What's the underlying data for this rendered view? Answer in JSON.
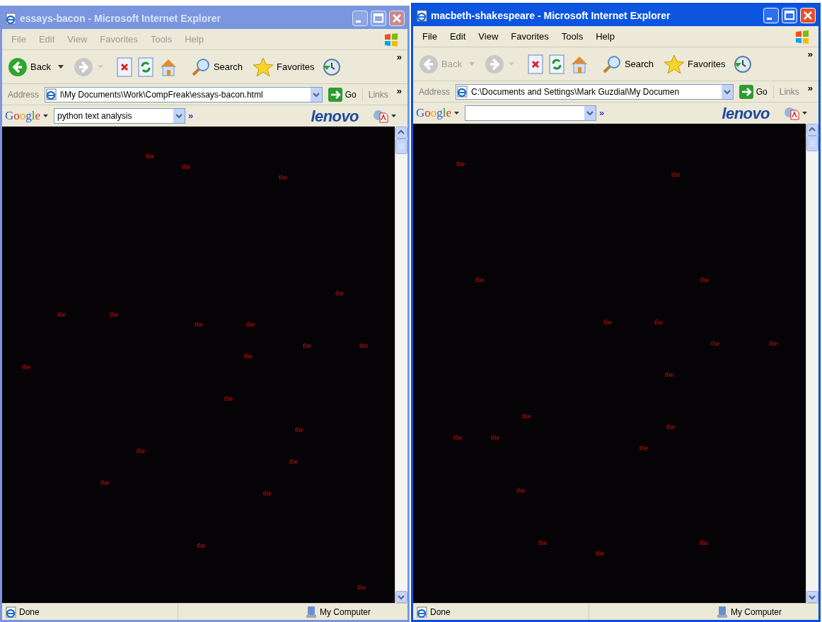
{
  "windows": [
    {
      "title": "essays-bacon - Microsoft Internet Explorer",
      "active": false,
      "menu": [
        "File",
        "Edit",
        "View",
        "Favorites",
        "Tools",
        "Help"
      ],
      "toolbar": {
        "back": {
          "label": "Back",
          "disabled": false
        },
        "search": "Search",
        "favorites": "Favorites",
        "more": "»"
      },
      "address": {
        "label": "Address",
        "value": "l\\My Documents\\Work\\CompFreak\\essays-bacon.html",
        "go": "Go",
        "links": "Links",
        "more": "»"
      },
      "google": {
        "logo": "Google",
        "query": "python text analysis",
        "more": "»",
        "brand": "lenovo"
      },
      "words": [
        "the",
        "the",
        "the",
        "the",
        "the",
        "the",
        "the",
        "the",
        "the",
        "the",
        "the",
        "the",
        "the",
        "the",
        "the",
        "the",
        "the",
        "the",
        "the",
        "the"
      ],
      "status": {
        "text": "Done",
        "zone": "My Computer"
      }
    },
    {
      "title": "macbeth-shakespeare - Microsoft Internet Explorer",
      "active": true,
      "menu": [
        "File",
        "Edit",
        "View",
        "Favorites",
        "Tools",
        "Help"
      ],
      "toolbar": {
        "back": {
          "label": "Back",
          "disabled": true
        },
        "search": "Search",
        "favorites": "Favorites",
        "more": "»"
      },
      "address": {
        "label": "Address",
        "value": "C:\\Documents and Settings\\Mark Guzdial\\My Documen",
        "go": "Go",
        "links": "Links",
        "more": "»"
      },
      "google": {
        "logo": "Google",
        "more": "»",
        "brand": "lenovo"
      },
      "words": [
        "the",
        "the",
        "the",
        "the",
        "the",
        "the",
        "the",
        "the",
        "the",
        "the",
        "the",
        "the",
        "the",
        "the",
        "the",
        "the",
        "the",
        "the"
      ],
      "status": {
        "text": "Done",
        "zone": "My Computer"
      }
    }
  ]
}
